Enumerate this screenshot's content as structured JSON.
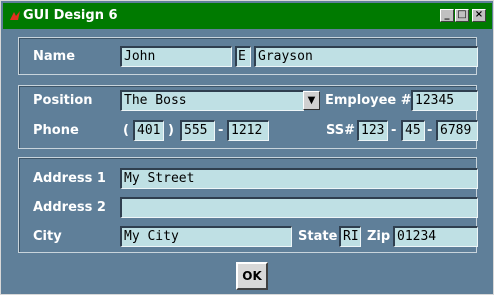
{
  "window": {
    "title": "GUI Design 6"
  },
  "titlebar_buttons": {
    "minimize": "_",
    "maximize": "□",
    "close": "×"
  },
  "name_section": {
    "label": "Name",
    "first": "John",
    "middle": "E",
    "last": "Grayson"
  },
  "job_section": {
    "position_label": "Position",
    "position_value": "The Boss",
    "dropdown_glyph": "▼",
    "employee_label": "Employee #",
    "employee_value": "12345",
    "phone_label": "Phone",
    "phone_open": "(",
    "phone_area": "401",
    "phone_close": ")",
    "phone_prefix": "555",
    "phone_dash": "-",
    "phone_line": "1212",
    "ssn_label": "SS#",
    "ssn_1": "123",
    "ssn_2": "45",
    "ssn_3": "6789",
    "ssn_dash1": "-",
    "ssn_dash2": "-"
  },
  "address_section": {
    "address1_label": "Address 1",
    "address1_value": "My Street",
    "address2_label": "Address 2",
    "address2_value": "",
    "city_label": "City",
    "city_value": "My City",
    "state_label": "State",
    "state_value": "RI",
    "zip_label": "Zip",
    "zip_value": "01234"
  },
  "ok_label": "OK"
}
